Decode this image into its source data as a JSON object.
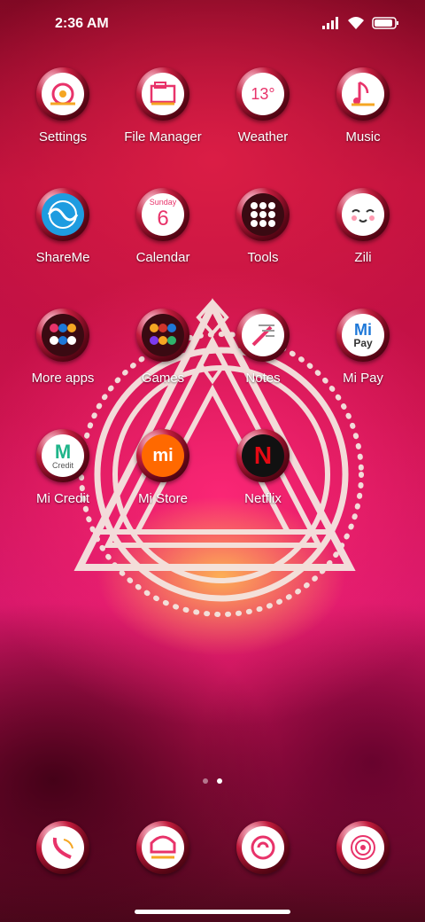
{
  "status_bar": {
    "time": "2:36 AM"
  },
  "apps": [
    {
      "label": "Settings"
    },
    {
      "label": "File Manager"
    },
    {
      "label": "Weather",
      "temp": "13°"
    },
    {
      "label": "Music"
    },
    {
      "label": "ShareMe"
    },
    {
      "label": "Calendar",
      "day_name": "Sunday",
      "day": "6"
    },
    {
      "label": "Tools"
    },
    {
      "label": "Zili"
    },
    {
      "label": "More apps"
    },
    {
      "label": "Games"
    },
    {
      "label": "Notes"
    },
    {
      "label": "Mi Pay",
      "mark": "Mi",
      "sub": "Pay"
    },
    {
      "label": "Mi Credit",
      "mark": "M",
      "sub": "Credit"
    },
    {
      "label": "Mi Store",
      "mark": "mi"
    },
    {
      "label": "Netflix",
      "mark": "N"
    }
  ],
  "page_indicator": {
    "pages": 2,
    "current": 2
  },
  "dock": [
    {},
    {},
    {},
    {}
  ],
  "colors": {
    "accent_pink": "#e81b78",
    "deep_red": "#7a0820",
    "netflix_red": "#e50914",
    "mi_orange": "#ff6900"
  }
}
